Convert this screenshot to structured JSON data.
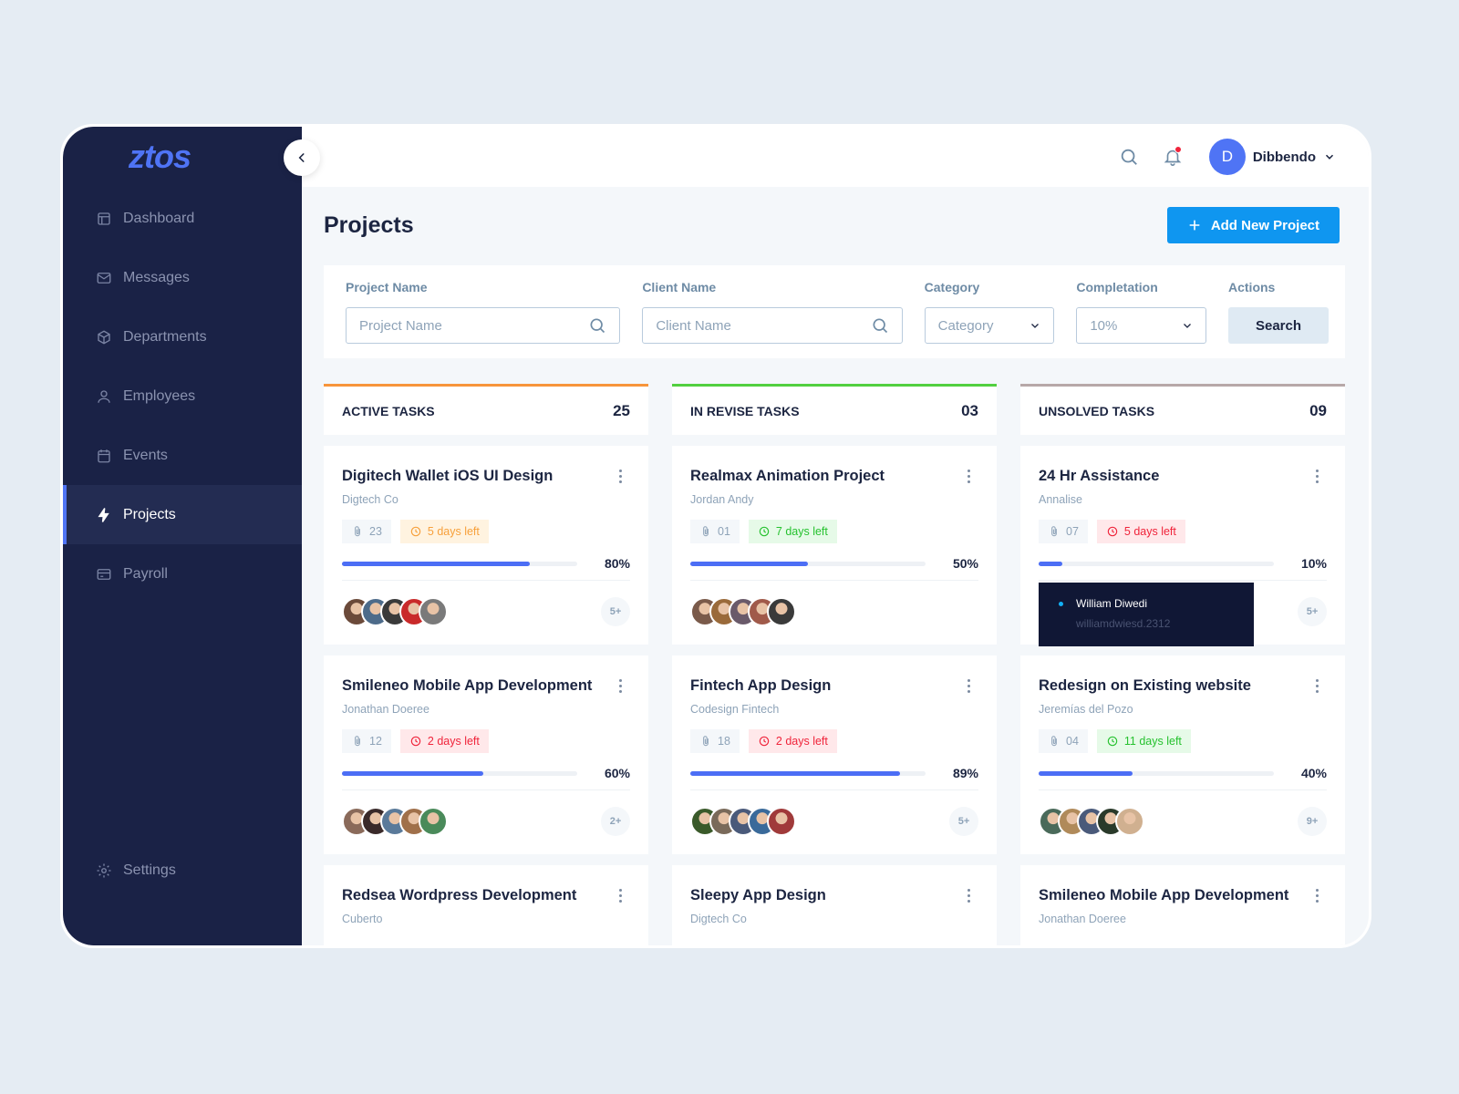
{
  "app": {
    "logo": "ztos"
  },
  "sidebar": {
    "items": [
      {
        "label": "Dashboard",
        "icon": "layout-icon"
      },
      {
        "label": "Messages",
        "icon": "mail-icon"
      },
      {
        "label": "Departments",
        "icon": "box-icon"
      },
      {
        "label": "Employees",
        "icon": "user-icon"
      },
      {
        "label": "Events",
        "icon": "calendar-icon"
      },
      {
        "label": "Projects",
        "icon": "bolt-icon",
        "active": true
      },
      {
        "label": "Payroll",
        "icon": "credit-card-icon"
      }
    ],
    "settings": "Settings"
  },
  "header": {
    "user_initial": "D",
    "user_name": "Dibbendo",
    "has_notification": true
  },
  "page": {
    "title": "Projects",
    "add_button": "Add New Project"
  },
  "filters": {
    "project_label": "Project Name",
    "project_placeholder": "Project Name",
    "client_label": "Client Name",
    "client_placeholder": "Client Name",
    "category_label": "Category",
    "category_value": "Category",
    "completion_label": "Completation",
    "completion_value": "10%",
    "actions_label": "Actions",
    "search_button": "Search"
  },
  "columns": [
    {
      "title": "ACTIVE TASKS",
      "count": "25",
      "color": "#f7953b",
      "cards": [
        {
          "title": "Digitech Wallet iOS UI Design",
          "client": "Digtech Co",
          "attachments": "23",
          "due": "5 days left",
          "due_status": "warning",
          "progress": 80,
          "progress_label": "80%",
          "more": "5+",
          "avatars": [
            "#6b4a3a",
            "#4d6b8a",
            "#3a3a3a",
            "#c92a2a",
            "#7a7a7a"
          ]
        },
        {
          "title": "Smileneo Mobile App Development",
          "client": "Jonathan Doeree",
          "attachments": "12",
          "due": "2 days left",
          "due_status": "danger",
          "progress": 60,
          "progress_label": "60%",
          "more": "2+",
          "avatars": [
            "#8a6a5a",
            "#3a2a2a",
            "#5a7a9a",
            "#a0704a",
            "#4a8a5a"
          ]
        },
        {
          "title": "Redsea Wordpress Development",
          "client": "Cuberto"
        }
      ]
    },
    {
      "title": "IN REVISE TASKS",
      "count": "03",
      "color": "#52d040",
      "cards": [
        {
          "title": "Realmax Animation Project",
          "client": "Jordan Andy",
          "attachments": "01",
          "due": "7 days left",
          "due_status": "success",
          "progress": 50,
          "progress_label": "50%",
          "more": "",
          "avatars": [
            "#7a5a4a",
            "#9a6a3a",
            "#6a5a6a",
            "#a05a4a",
            "#3a3a3a"
          ]
        },
        {
          "title": "Fintech App Design",
          "client": "Codesign Fintech",
          "attachments": "18",
          "due": "2 days left",
          "due_status": "danger",
          "progress": 89,
          "progress_label": "89%",
          "more": "5+",
          "avatars": [
            "#3a5a2a",
            "#7a6a5a",
            "#4a5a7a",
            "#3a6a9a",
            "#a03a3a"
          ]
        },
        {
          "title": "Sleepy App Design",
          "client": "Digtech Co"
        }
      ]
    },
    {
      "title": "UNSOLVED TASKS",
      "count": "09",
      "color": "#b7a8a8",
      "cards": [
        {
          "title": "24 Hr Assistance",
          "client": "Annalise",
          "attachments": "07",
          "due": "5 days left",
          "due_status": "danger",
          "progress": 10,
          "progress_label": "10%",
          "more": "5+",
          "avatars": [
            "#6b4a3a",
            "#4d6b8a",
            "#3a3a3a",
            "#c92a2a",
            "#8a8a8a"
          ]
        },
        {
          "title": "Redesign on Existing website",
          "client": "Jeremías del Pozo",
          "attachments": "04",
          "due": "11 days left",
          "due_status": "success",
          "progress": 40,
          "progress_label": "40%",
          "more": "9+",
          "avatars": [
            "#4a6a5a",
            "#b08a5a",
            "#4a5a7a",
            "#2a3a2a",
            "#d0b090"
          ]
        },
        {
          "title": "Smileneo Mobile App Development",
          "client": "Jonathan Doeree"
        }
      ]
    }
  ],
  "tooltip": {
    "name": "William Diwedi",
    "username": "williamdwiesd.2312"
  },
  "status_colors": {
    "warning": {
      "bg": "#fff3e0",
      "fg": "#f7a03b"
    },
    "danger": {
      "bg": "#ffe8ea",
      "fg": "#f0243b"
    },
    "success": {
      "bg": "#e6fae8",
      "fg": "#26c22f"
    }
  }
}
